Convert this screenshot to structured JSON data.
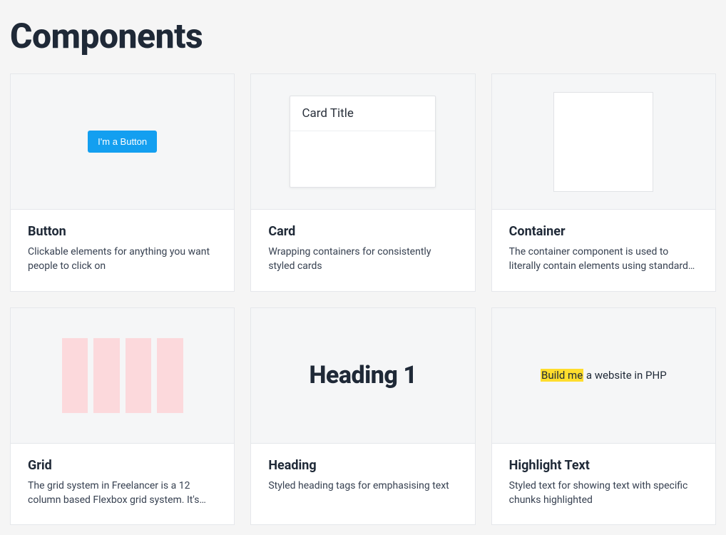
{
  "page": {
    "title": "Components"
  },
  "cards": {
    "button": {
      "title": "Button",
      "desc": "Clickable elements for anything you want people to click on",
      "preview_label": "I'm a Button"
    },
    "card": {
      "title": "Card",
      "desc": "Wrapping containers for consistently styled cards",
      "preview_title": "Card Title"
    },
    "container": {
      "title": "Container",
      "desc": "The container component is used to literally contain elements using standard…"
    },
    "grid": {
      "title": "Grid",
      "desc": "The grid system in Freelancer is a 12 column based Flexbox grid system. It's…"
    },
    "heading": {
      "title": "Heading",
      "desc": "Styled heading tags for emphasising text",
      "preview_text": "Heading 1"
    },
    "highlight": {
      "title": "Highlight Text",
      "desc": "Styled text for showing text with specific chunks highlighted",
      "preview_highlight": "Build me",
      "preview_rest": " a website in PHP"
    }
  }
}
